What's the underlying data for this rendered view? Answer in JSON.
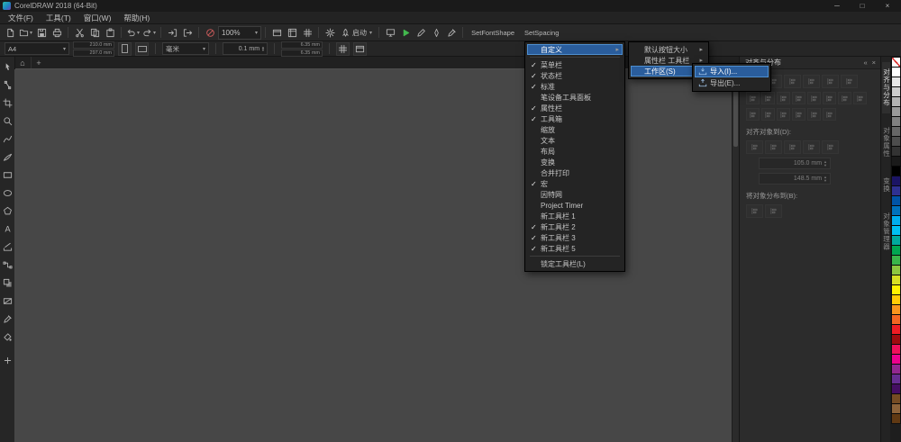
{
  "titlebar": {
    "title": "CorelDRAW 2018 (64-Bit)",
    "minimize": "─",
    "maximize": "□",
    "close": "×"
  },
  "menubar": {
    "items": [
      "文件(F)",
      "工具(T)",
      "窗口(W)",
      "帮助(H)"
    ]
  },
  "standard_toolbar": {
    "launch_label": "启动",
    "items": [
      {
        "icon": "new-document-icon"
      },
      {
        "icon": "open-folder-icon",
        "dropdown": true
      },
      {
        "icon": "save-icon"
      },
      {
        "icon": "print-icon"
      },
      {
        "sep": true
      },
      {
        "icon": "cut-icon"
      },
      {
        "icon": "copy-icon"
      },
      {
        "icon": "paste-icon"
      },
      {
        "sep": true
      },
      {
        "icon": "undo-icon",
        "dropdown": true
      },
      {
        "icon": "redo-icon",
        "dropdown": true
      },
      {
        "sep": true
      },
      {
        "icon": "import-icon"
      },
      {
        "icon": "export-icon"
      },
      {
        "sep": true
      },
      {
        "icon": "prohibit-icon"
      },
      {
        "combo": "100%",
        "name": "zoom-level-combo"
      },
      {
        "sep": true
      },
      {
        "icon": "fullscreen-icon"
      },
      {
        "icon": "rulers-icon"
      },
      {
        "icon": "grid-icon"
      },
      {
        "sep": true
      },
      {
        "icon": "options-gear-icon"
      },
      {
        "launch": true
      },
      {
        "sep": true
      },
      {
        "icon": "monitor-icon"
      },
      {
        "icon": "play-icon"
      },
      {
        "icon": "pencil-icon"
      },
      {
        "icon": "pen-icon"
      },
      {
        "icon": "eyedropper-icon"
      },
      {
        "sep": true
      },
      {
        "text": "SetFontShape",
        "name": "setfontshape-button"
      },
      {
        "text": "SetSpacing",
        "name": "setspacing-button"
      }
    ]
  },
  "property_bar": {
    "page_size_value": "A4",
    "page_width": "210.0 mm",
    "page_height": "297.0 mm",
    "units_value": "毫米",
    "nudge_value": "0.1 mm",
    "duplicate_x": "6.35 mm",
    "duplicate_y": "6.35 mm"
  },
  "document_tabs": {
    "home_icon": "⌂",
    "add_icon": "+"
  },
  "toolbox": {
    "tools": [
      {
        "name": "pick-tool-icon"
      },
      {
        "name": "shape-tool-icon"
      },
      {
        "name": "crop-tool-icon"
      },
      {
        "name": "zoom-tool-icon"
      },
      {
        "name": "freehand-tool-icon"
      },
      {
        "name": "artistic-media-tool-icon"
      },
      {
        "name": "rectangle-tool-icon"
      },
      {
        "name": "ellipse-tool-icon"
      },
      {
        "name": "polygon-tool-icon"
      },
      {
        "name": "text-tool-icon"
      },
      {
        "name": "dimension-tool-icon"
      },
      {
        "name": "connector-tool-icon"
      },
      {
        "name": "drop-shadow-tool-icon"
      },
      {
        "name": "transparency-tool-icon"
      },
      {
        "name": "eyedropper-tool-icon"
      },
      {
        "name": "interactive-fill-tool-icon"
      },
      {
        "name": "add-tools-icon"
      }
    ]
  },
  "context_menu": {
    "items": [
      {
        "label": "自定义",
        "submenu": true,
        "highlighted": true
      },
      {
        "separator": true
      },
      {
        "label": "菜单栏",
        "checked": true
      },
      {
        "label": "状态栏",
        "checked": true
      },
      {
        "label": "标准",
        "checked": true
      },
      {
        "label": "笔设备工具面板"
      },
      {
        "label": "属性栏",
        "checked": true
      },
      {
        "label": "工具箱",
        "checked": true
      },
      {
        "label": "缩放"
      },
      {
        "label": "文本"
      },
      {
        "label": "布局"
      },
      {
        "label": "变换"
      },
      {
        "label": "合并打印"
      },
      {
        "label": "宏",
        "checked": true
      },
      {
        "label": "因特网"
      },
      {
        "label": "Project Timer"
      },
      {
        "label": "新工具栏 1"
      },
      {
        "label": "新工具栏 2",
        "checked": true
      },
      {
        "label": "新工具栏 3",
        "checked": true
      },
      {
        "label": "新工具栏 5",
        "checked": true
      },
      {
        "separator": true
      },
      {
        "label": "锁定工具栏(L)"
      }
    ]
  },
  "customize_submenu": {
    "items": [
      {
        "label": "默认按钮大小",
        "submenu": true
      },
      {
        "label": "属性栏 工具栏",
        "submenu": true
      },
      {
        "label": "工作区(S)",
        "submenu": true,
        "highlighted": true
      }
    ]
  },
  "workspace_submenu": {
    "items": [
      {
        "label": "导入(I)...",
        "icon": "import-workspace-icon",
        "highlighted": true
      },
      {
        "label": "导出(E)...",
        "icon": "export-workspace-icon"
      }
    ]
  },
  "docker": {
    "title": "对齐与分布",
    "align_to_label": "对齐对象到(D):",
    "distribute_to_label": "将对象分布到(B):",
    "x_value": "105.0 mm",
    "y_value": "148.5 mm",
    "align_buttons": [
      "align-left-icon",
      "align-center-horizontal-icon",
      "align-right-icon",
      "align-top-icon",
      "align-center-vertical-icon",
      "align-bottom-icon"
    ],
    "distribute_buttons": [
      "distribute-left-icon",
      "distribute-center-h-icon",
      "distribute-spacing-h-icon",
      "distribute-right-icon",
      "distribute-top-icon",
      "distribute-center-v-icon",
      "distribute-spacing-v-icon",
      "distribute-bottom-icon"
    ],
    "text_buttons": [
      "align-first-line-icon",
      "align-baseline-icon",
      "align-bounding-box-icon",
      "text-option-icon",
      "outline-option-icon",
      "more-options-icon"
    ],
    "align_to_buttons": [
      "active-objects-icon",
      "page-edge-icon",
      "page-center-icon",
      "grid-snap-icon",
      "specified-point-icon"
    ],
    "distribute_to_buttons": [
      "selection-extent-icon",
      "page-extent-icon"
    ]
  },
  "right_tabs": {
    "items": [
      {
        "label": "对齐与分布",
        "active": true
      },
      {
        "label": "对象属性"
      },
      {
        "label": "变换"
      },
      {
        "label": "对象管理器"
      }
    ]
  },
  "palette": {
    "colors": [
      "#ffffff",
      "#e6e6e6",
      "#cccccc",
      "#b3b3b3",
      "#999999",
      "#808080",
      "#666666",
      "#4d4d4d",
      "#333333",
      "#1a1a1a",
      "#000000",
      "#1b1464",
      "#2e3192",
      "#0054a6",
      "#0072bc",
      "#00aeef",
      "#00c0f3",
      "#00a99d",
      "#00a651",
      "#39b54a",
      "#8dc63f",
      "#d7df23",
      "#fff200",
      "#ffcb05",
      "#f7941d",
      "#f26522",
      "#ed1c24",
      "#9e0b0f",
      "#ee105a",
      "#ec008c",
      "#92278f",
      "#662d91",
      "#440e62",
      "#754c24",
      "#8c6239",
      "#603913"
    ]
  }
}
